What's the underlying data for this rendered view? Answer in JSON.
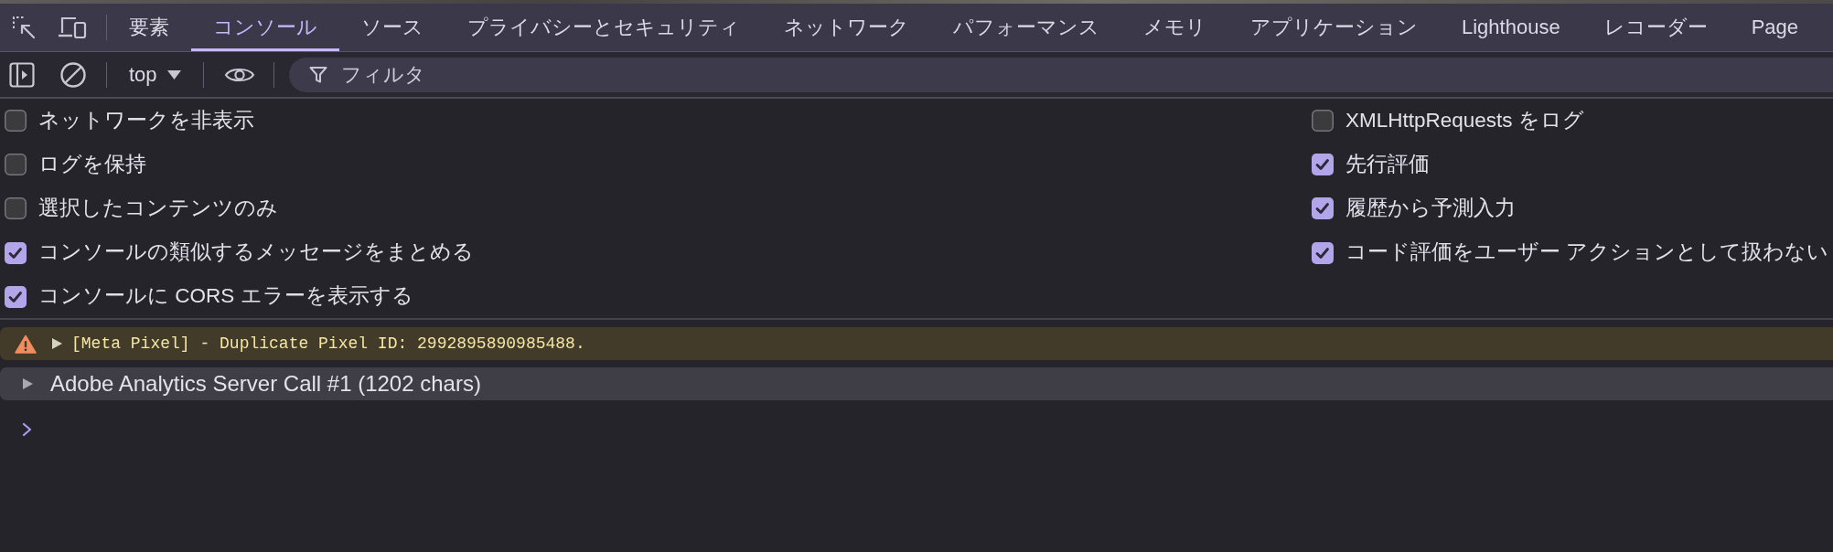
{
  "tabs": [
    {
      "label": "要素",
      "selected": false
    },
    {
      "label": "コンソール",
      "selected": true
    },
    {
      "label": "ソース",
      "selected": false
    },
    {
      "label": "プライバシーとセキュリティ",
      "selected": false
    },
    {
      "label": "ネットワーク",
      "selected": false
    },
    {
      "label": "パフォーマンス",
      "selected": false
    },
    {
      "label": "メモリ",
      "selected": false
    },
    {
      "label": "アプリケーション",
      "selected": false
    },
    {
      "label": "Lighthouse",
      "selected": false
    },
    {
      "label": "レコーダー",
      "selected": false
    },
    {
      "label": "Page",
      "selected": false
    }
  ],
  "toolbar": {
    "context": "top",
    "filter": {
      "placeholder": "フィルタ"
    }
  },
  "settings": {
    "left": [
      {
        "label": "ネットワークを非表示",
        "checked": false
      },
      {
        "label": "ログを保持",
        "checked": false
      },
      {
        "label": "選択したコンテンツのみ",
        "checked": false
      },
      {
        "label": "コンソールの類似するメッセージをまとめる",
        "checked": true
      },
      {
        "label": "コンソールに CORS エラーを表示する",
        "checked": true
      }
    ],
    "right": [
      {
        "label": "XMLHttpRequests をログ",
        "checked": false
      },
      {
        "label": "先行評価",
        "checked": true
      },
      {
        "label": "履歴から予測入力",
        "checked": true
      },
      {
        "label": "コード評価をユーザー アクションとして扱わない",
        "checked": true
      }
    ]
  },
  "messages": [
    {
      "kind": "warning",
      "text": "[Meta Pixel] - Duplicate Pixel ID: 2992895890985488.",
      "expanded": false
    },
    {
      "kind": "log",
      "text": "Adobe Analytics Server Call #1 (1202 chars)",
      "expanded": false
    }
  ]
}
